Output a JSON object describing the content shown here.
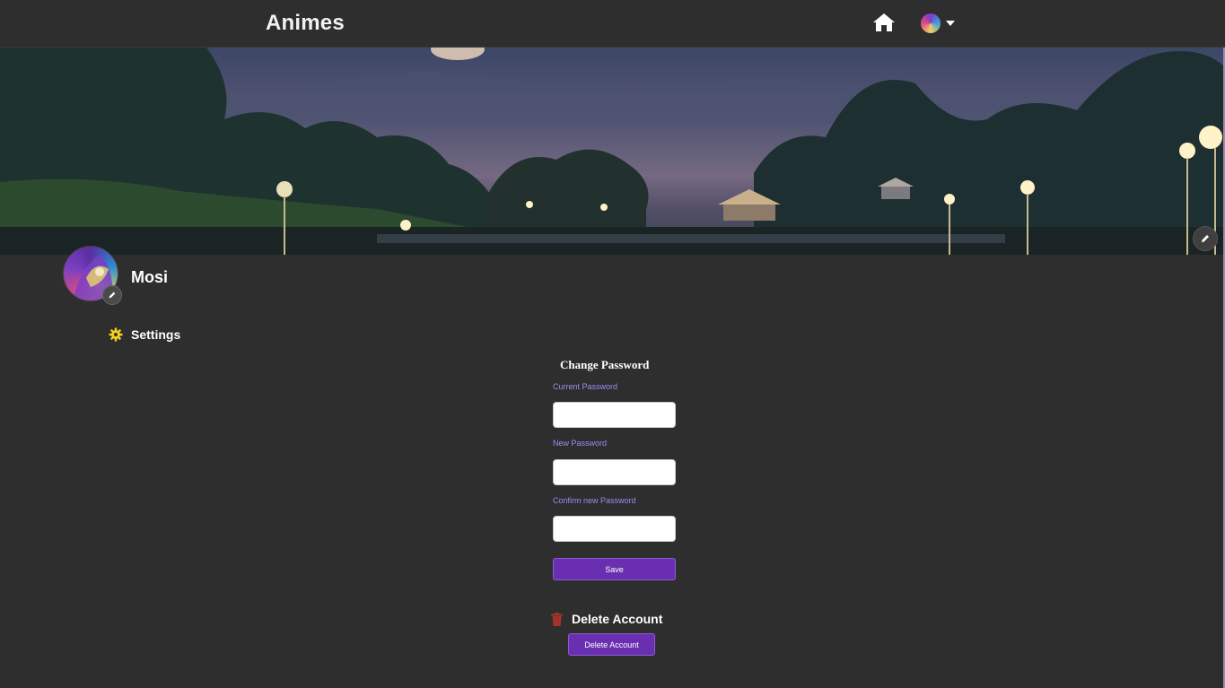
{
  "navbar": {
    "brand": "Animes",
    "icons": {
      "home": "home-icon",
      "avatar": "user-avatar",
      "caret": "caret-down-icon"
    }
  },
  "profile": {
    "username": "Mosi",
    "avatar_edit_icon": "pencil-icon",
    "banner_edit_icon": "pencil-icon"
  },
  "settings": {
    "label": "Settings",
    "icon": "gear-icon",
    "icon_color": "#f2d21c"
  },
  "change_password": {
    "title": "Change Password",
    "current_label": "Current Password",
    "new_label": "New Password",
    "confirm_label": "Confirm new Password",
    "current_value": "",
    "new_value": "",
    "confirm_value": "",
    "save_label": "Save"
  },
  "delete_account": {
    "title": "Delete Account",
    "icon": "trash-icon",
    "icon_color": "#a0342a",
    "button_label": "Delete Account"
  },
  "colors": {
    "background": "#2e2e2e",
    "accent": "#6a2fb0",
    "label": "#9d8df2"
  }
}
